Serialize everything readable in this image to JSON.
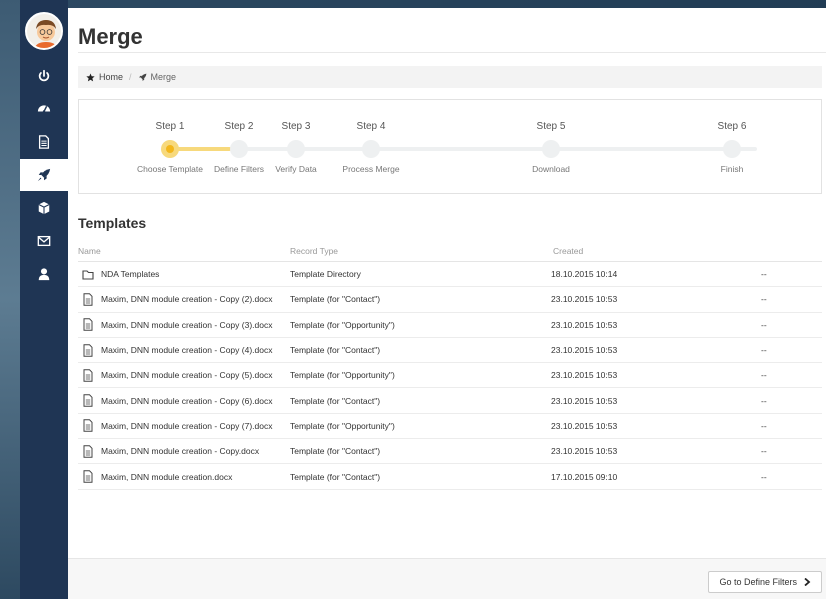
{
  "page": {
    "title": "Merge"
  },
  "breadcrumb": {
    "home": "Home",
    "current": "Merge"
  },
  "wizard": {
    "steps": [
      {
        "number": "Step 1",
        "label": "Choose Template"
      },
      {
        "number": "Step 2",
        "label": "Define Filters"
      },
      {
        "number": "Step 3",
        "label": "Verify Data"
      },
      {
        "number": "Step 4",
        "label": "Process Merge"
      },
      {
        "number": "Step 5",
        "label": "Download"
      },
      {
        "number": "Step 6",
        "label": "Finish"
      }
    ],
    "active_step": 1
  },
  "templates": {
    "title": "Templates",
    "columns": [
      "Name",
      "Record Type",
      "Created"
    ],
    "rows": [
      {
        "icon": "folder-icon",
        "name": "NDA Templates",
        "type": "Template Directory",
        "created": "18.10.2015 10:14",
        "extra": "--"
      },
      {
        "icon": "document-icon",
        "name": "Maxim, DNN module creation - Copy (2).docx",
        "type": "Template (for \"Contact\")",
        "created": "23.10.2015 10:53",
        "extra": "--"
      },
      {
        "icon": "document-icon",
        "name": "Maxim, DNN module creation - Copy (3).docx",
        "type": "Template (for \"Opportunity\")",
        "created": "23.10.2015 10:53",
        "extra": "--"
      },
      {
        "icon": "document-icon",
        "name": "Maxim, DNN module creation - Copy (4).docx",
        "type": "Template (for \"Contact\")",
        "created": "23.10.2015 10:53",
        "extra": "--"
      },
      {
        "icon": "document-icon",
        "name": "Maxim, DNN module creation - Copy (5).docx",
        "type": "Template (for \"Opportunity\")",
        "created": "23.10.2015 10:53",
        "extra": "--"
      },
      {
        "icon": "document-icon",
        "name": "Maxim, DNN module creation - Copy (6).docx",
        "type": "Template (for \"Contact\")",
        "created": "23.10.2015 10:53",
        "extra": "--"
      },
      {
        "icon": "document-icon",
        "name": "Maxim, DNN module creation - Copy (7).docx",
        "type": "Template (for \"Opportunity\")",
        "created": "23.10.2015 10:53",
        "extra": "--"
      },
      {
        "icon": "document-icon",
        "name": "Maxim, DNN module creation - Copy.docx",
        "type": "Template (for \"Contact\")",
        "created": "23.10.2015 10:53",
        "extra": "--"
      },
      {
        "icon": "document-icon",
        "name": "Maxim, DNN module creation.docx",
        "type": "Template (for \"Contact\")",
        "created": "17.10.2015 09:10",
        "extra": "--"
      }
    ]
  },
  "footer": {
    "next_label": "Go to Define Filters"
  },
  "sidebar": {
    "icons": [
      "power-icon",
      "dashboard-icon",
      "document-icon",
      "rocket-icon",
      "cube-icon",
      "mail-icon",
      "user-icon"
    ],
    "active": "rocket-icon"
  },
  "colors": {
    "sidebar": "#1f3554",
    "accent": "#f3b71c",
    "accent_light": "#f7d97c"
  }
}
